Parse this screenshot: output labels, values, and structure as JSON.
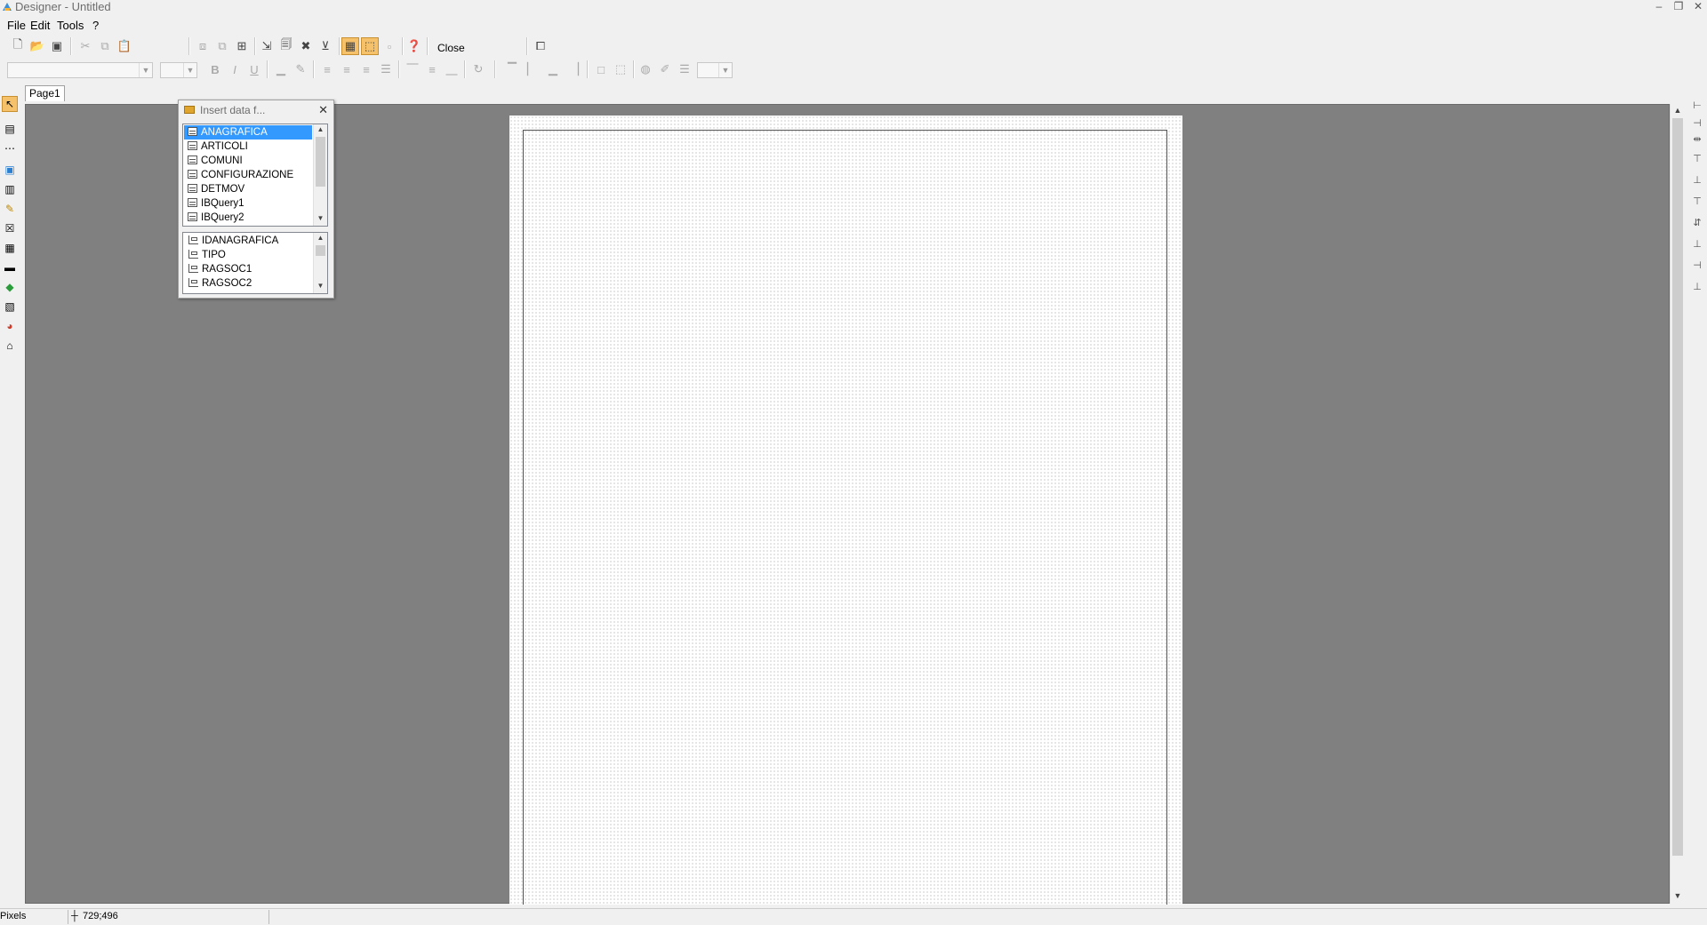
{
  "window": {
    "title": "Designer - Untitled"
  },
  "menu": [
    {
      "label": "File"
    },
    {
      "label": "Edit"
    },
    {
      "label": "Tools"
    },
    {
      "label": "?"
    }
  ],
  "toolbar": {
    "close_label": "Close"
  },
  "tabs": [
    {
      "label": "Page1"
    }
  ],
  "dialog": {
    "title": "Insert data f...",
    "datasets": [
      "ANAGRAFICA",
      "ARTICOLI",
      "COMUNI",
      "CONFIGURAZIONE",
      "DETMOV",
      "IBQuery1",
      "IBQuery2"
    ],
    "selected_dataset": "ANAGRAFICA",
    "fields": [
      "IDANAGRAFICA",
      "TIPO",
      "RAGSOC1",
      "RAGSOC2"
    ]
  },
  "statusbar": {
    "units": "Pixels",
    "coordinates": "729;496"
  }
}
